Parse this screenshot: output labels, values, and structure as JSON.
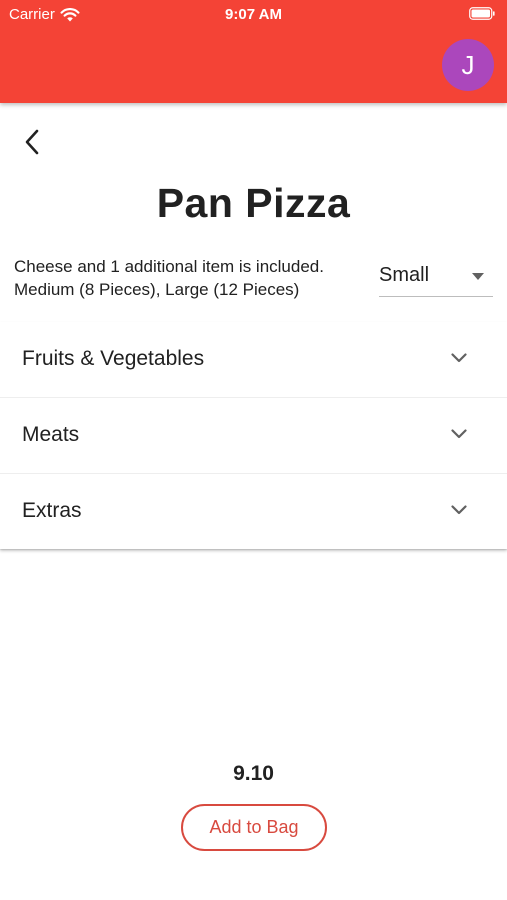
{
  "status_bar": {
    "carrier": "Carrier",
    "time": "9:07 AM",
    "wifi_icon": "wifi-icon",
    "battery_icon": "battery-icon"
  },
  "app_bar": {
    "color": "#f44336",
    "avatar_initial": "J",
    "avatar_color": "#ab47bc"
  },
  "nav": {
    "back_icon": "back-arrow-icon"
  },
  "product": {
    "title": "Pan Pizza",
    "description_line1": "Cheese and 1 additional item is included.",
    "description_line2": "Medium (8 Pieces), Large (12 Pieces)",
    "size_selected": "Small",
    "size_dropdown_icon": "caret-down-icon"
  },
  "panels": [
    {
      "label": "Fruits & Vegetables",
      "icon": "chevron-down-icon"
    },
    {
      "label": "Meats",
      "icon": "chevron-down-icon"
    },
    {
      "label": "Extras",
      "icon": "chevron-down-icon"
    }
  ],
  "footer": {
    "price": "9.10",
    "add_button_label": "Add to Bag",
    "accent_color": "#d84a3f"
  }
}
